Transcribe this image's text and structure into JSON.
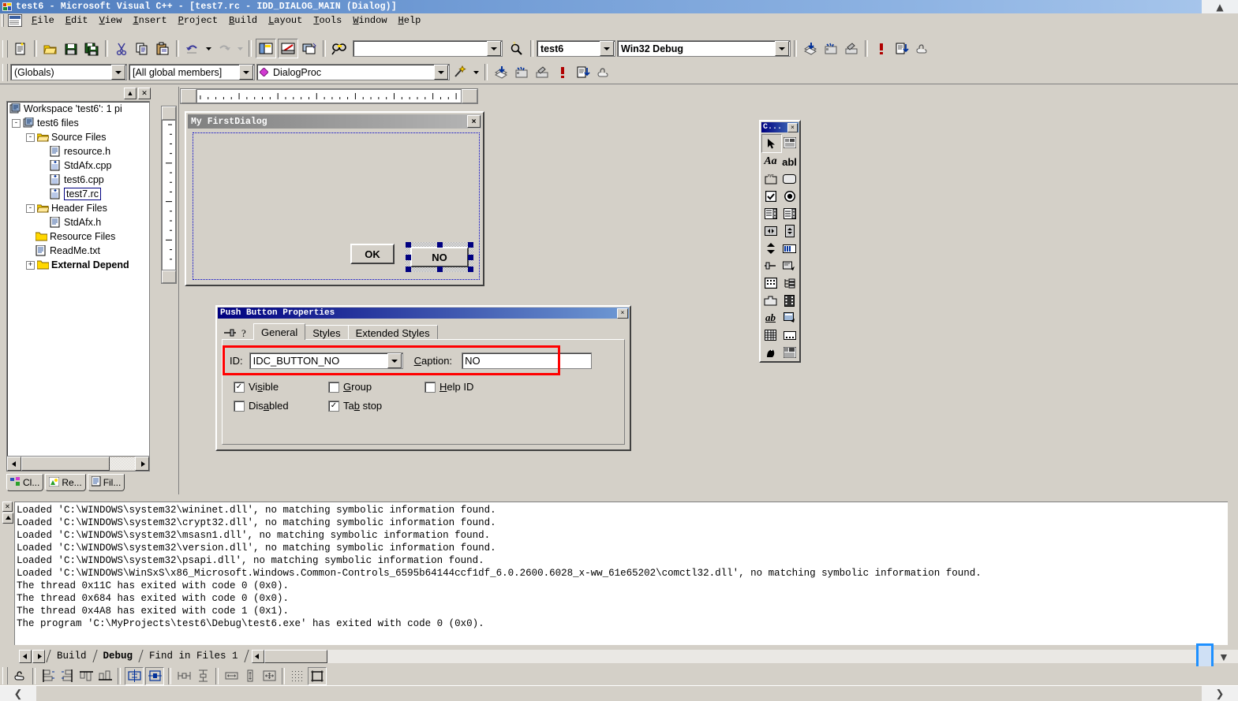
{
  "window": {
    "title": "test6 - Microsoft Visual C++ - [test7.rc - IDD_DIALOG_MAIN (Dialog)]",
    "app_icon": "vcpp-icon",
    "restore_chevron": "chevron-up-icon"
  },
  "menu": {
    "items": [
      {
        "label": "File"
      },
      {
        "label": "Edit"
      },
      {
        "label": "View"
      },
      {
        "label": "Insert"
      },
      {
        "label": "Project"
      },
      {
        "label": "Build"
      },
      {
        "label": "Layout"
      },
      {
        "label": "Tools"
      },
      {
        "label": "Window"
      },
      {
        "label": "Help"
      }
    ]
  },
  "toolbar_standard": {
    "buttons": [
      {
        "name": "new-document-icon"
      },
      {
        "name": "open-folder-icon"
      },
      {
        "name": "save-icon"
      },
      {
        "name": "save-all-icon"
      },
      {
        "name": "cut-icon"
      },
      {
        "name": "copy-icon"
      },
      {
        "name": "paste-icon"
      },
      {
        "name": "undo-icon"
      },
      {
        "name": "undo-dropdown-icon"
      },
      {
        "name": "redo-icon"
      },
      {
        "name": "redo-dropdown-icon"
      },
      {
        "name": "workspace-toggle-icon"
      },
      {
        "name": "output-toggle-icon"
      },
      {
        "name": "window-list-icon"
      },
      {
        "name": "find-in-files-icon"
      }
    ],
    "find_value": "",
    "find_placeholder": "",
    "help_icon": "help-search-icon"
  },
  "toolbar_build": {
    "project_value": "test6",
    "config_value": "Win32 Debug",
    "buttons": [
      {
        "name": "compile-icon"
      },
      {
        "name": "build-icon"
      },
      {
        "name": "stop-build-icon"
      },
      {
        "name": "execute-program-icon"
      },
      {
        "name": "go-debug-icon"
      },
      {
        "name": "insert-breakpoint-icon"
      }
    ]
  },
  "toolbar_wizardbar": {
    "scope_value": "(Globals)",
    "members_value": "[All global members]",
    "function_value": "DialogProc",
    "function_glyph": "member-diamond-icon",
    "actions_icon": "wizard-wand-icon",
    "buttons": [
      {
        "name": "compile-icon"
      },
      {
        "name": "build-icon"
      },
      {
        "name": "stop-build-icon"
      },
      {
        "name": "execute-program-icon"
      },
      {
        "name": "go-debug-icon"
      },
      {
        "name": "insert-breakpoint-icon"
      }
    ]
  },
  "workspace": {
    "collapse_icon": "collapse-icon",
    "close_icon": "close-icon",
    "tree": [
      {
        "depth": 0,
        "label": "Workspace 'test6': 1 pi",
        "icon": "workspace-icon",
        "expander": "",
        "selected": false
      },
      {
        "depth": 1,
        "label": "test6 files",
        "icon": "project-icon",
        "expander": "-",
        "selected": false
      },
      {
        "depth": 2,
        "label": "Source Files",
        "icon": "folder-open-icon",
        "expander": "-",
        "selected": false
      },
      {
        "depth": 3,
        "label": "resource.h",
        "icon": "header-file-icon",
        "expander": "",
        "selected": false
      },
      {
        "depth": 3,
        "label": "StdAfx.cpp",
        "icon": "cpp-file-icon",
        "expander": "",
        "selected": false
      },
      {
        "depth": 3,
        "label": "test6.cpp",
        "icon": "cpp-file-icon",
        "expander": "",
        "selected": false
      },
      {
        "depth": 3,
        "label": "test7.rc",
        "icon": "cpp-file-icon",
        "expander": "",
        "selected": true
      },
      {
        "depth": 2,
        "label": "Header Files",
        "icon": "folder-open-icon",
        "expander": "-",
        "selected": false
      },
      {
        "depth": 3,
        "label": "StdAfx.h",
        "icon": "header-file-icon",
        "expander": "",
        "selected": false
      },
      {
        "depth": 2,
        "label": "Resource Files",
        "icon": "folder-icon",
        "expander": "",
        "selected": false
      },
      {
        "depth": 2,
        "label": "ReadMe.txt",
        "icon": "text-file-icon",
        "expander": "",
        "selected": false
      },
      {
        "depth": 2,
        "label": "External Depend",
        "icon": "folder-icon",
        "expander": "+",
        "selected": false
      }
    ],
    "tabs": [
      {
        "label": "Cl...",
        "icon": "class-view-icon",
        "active": false
      },
      {
        "label": "Re...",
        "icon": "resource-view-icon",
        "active": false
      },
      {
        "label": "Fil...",
        "icon": "file-view-icon",
        "active": true
      }
    ]
  },
  "dialog_editor": {
    "dialog_title": "My FirstDialog",
    "close_label": "×",
    "buttons": [
      {
        "label": "OK",
        "selected": false
      },
      {
        "label": "NO",
        "selected": true
      }
    ]
  },
  "toolbox": {
    "title": "C...",
    "close_label": "×",
    "controls": [
      {
        "name": "select-pointer-icon",
        "active": true
      },
      {
        "name": "picture-control-icon",
        "active": false
      },
      {
        "name": "static-text-icon",
        "active": false
      },
      {
        "name": "edit-box-icon",
        "active": false
      },
      {
        "name": "group-box-icon",
        "active": false
      },
      {
        "name": "push-button-icon",
        "active": false
      },
      {
        "name": "check-box-icon",
        "active": false
      },
      {
        "name": "radio-button-icon",
        "active": false
      },
      {
        "name": "combo-box-icon",
        "active": false
      },
      {
        "name": "list-box-icon",
        "active": false
      },
      {
        "name": "horizontal-scroll-bar-icon",
        "active": false
      },
      {
        "name": "vertical-scroll-bar-icon",
        "active": false
      },
      {
        "name": "spin-control-icon",
        "active": false
      },
      {
        "name": "progress-bar-icon",
        "active": false
      },
      {
        "name": "slider-icon",
        "active": false
      },
      {
        "name": "hot-key-icon",
        "active": false
      },
      {
        "name": "list-control-icon",
        "active": false
      },
      {
        "name": "tree-control-icon",
        "active": false
      },
      {
        "name": "tab-control-icon",
        "active": false
      },
      {
        "name": "animate-control-icon",
        "active": false
      },
      {
        "name": "rich-edit-icon",
        "active": false
      },
      {
        "name": "date-time-picker-icon",
        "active": false
      },
      {
        "name": "month-calendar-icon",
        "active": false
      },
      {
        "name": "ip-address-icon",
        "active": false
      },
      {
        "name": "custom-control-icon",
        "active": false
      },
      {
        "name": "extended-combo-box-icon",
        "active": false
      }
    ]
  },
  "properties_dialog": {
    "title": "Push Button Properties",
    "close_label": "×",
    "pin_icon": "pushpin-icon",
    "help_icon": "help-question-icon",
    "tabs": [
      {
        "label": "General",
        "active": true
      },
      {
        "label": "Styles",
        "active": false
      },
      {
        "label": "Extended Styles",
        "active": false
      }
    ],
    "id_label": "ID:",
    "id_value": "IDC_BUTTON_NO",
    "caption_label": "Caption:",
    "caption_value": "NO",
    "checkboxes": [
      {
        "label": "Visible",
        "checked": true
      },
      {
        "label": "Group",
        "checked": false
      },
      {
        "label": "Help ID",
        "checked": false
      },
      {
        "label": "Disabled",
        "checked": false
      },
      {
        "label": "Tab stop",
        "checked": true
      }
    ],
    "highlight_color": "#ff0000"
  },
  "output_pane": {
    "close_icon": "close-icon",
    "scroll_up_icon": "scroll-up-icon",
    "lines": [
      "Loaded 'C:\\WINDOWS\\system32\\wininet.dll', no matching symbolic information found.",
      "Loaded 'C:\\WINDOWS\\system32\\crypt32.dll', no matching symbolic information found.",
      "Loaded 'C:\\WINDOWS\\system32\\msasn1.dll', no matching symbolic information found.",
      "Loaded 'C:\\WINDOWS\\system32\\version.dll', no matching symbolic information found.",
      "Loaded 'C:\\WINDOWS\\system32\\psapi.dll', no matching symbolic information found.",
      "Loaded 'C:\\WINDOWS\\WinSxS\\x86_Microsoft.Windows.Common-Controls_6595b64144ccf1df_6.0.2600.6028_x-ww_61e65202\\comctl32.dll', no matching symbolic information found.",
      "The thread 0x11C has exited with code 0 (0x0).",
      "The thread 0x684 has exited with code 0 (0x0).",
      "The thread 0x4A8 has exited with code 1 (0x1).",
      "The program 'C:\\MyProjects\\test6\\Debug\\test6.exe' has exited with code 0 (0x0)."
    ],
    "tabs": [
      {
        "label": "Build",
        "active": false
      },
      {
        "label": "Debug",
        "active": true
      },
      {
        "label": "Find in Files 1",
        "active": false
      }
    ]
  },
  "dialog_toolbar": {
    "buttons": [
      {
        "name": "test-dialog-icon",
        "pressed": false
      },
      {
        "name": "align-left-icon",
        "pressed": false
      },
      {
        "name": "align-right-icon",
        "pressed": false
      },
      {
        "name": "align-top-icon",
        "pressed": false
      },
      {
        "name": "align-bottom-icon",
        "pressed": false
      },
      {
        "name": "center-vertical-icon",
        "pressed": true
      },
      {
        "name": "center-horizontal-icon",
        "pressed": true
      },
      {
        "name": "space-across-icon",
        "pressed": false
      },
      {
        "name": "space-down-icon",
        "pressed": false
      },
      {
        "name": "make-same-width-icon",
        "pressed": false
      },
      {
        "name": "make-same-height-icon",
        "pressed": false
      },
      {
        "name": "make-same-size-icon",
        "pressed": false
      },
      {
        "name": "toggle-grid-icon",
        "pressed": false
      },
      {
        "name": "toggle-guides-icon",
        "pressed": true
      }
    ]
  },
  "status_bar": {
    "left_chevron": "chevron-left-icon",
    "right_chevron": "chevron-right-icon",
    "message": ""
  }
}
